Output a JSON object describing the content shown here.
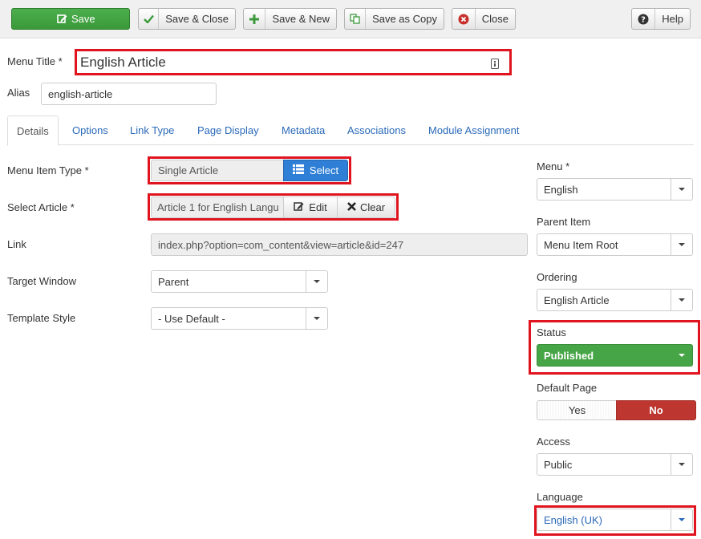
{
  "toolbar": {
    "save": "Save",
    "save_close": "Save & Close",
    "save_new": "Save & New",
    "save_copy": "Save as Copy",
    "close": "Close",
    "help": "Help"
  },
  "form": {
    "menu_title_label": "Menu Title *",
    "menu_title_value": "English Article",
    "alias_label": "Alias",
    "alias_value": "english-article"
  },
  "tabs": [
    "Details",
    "Options",
    "Link Type",
    "Page Display",
    "Metadata",
    "Associations",
    "Module Assignment"
  ],
  "details": {
    "menu_item_type_label": "Menu Item Type *",
    "menu_item_type_value": "Single Article",
    "select_button": "Select",
    "select_article_label": "Select Article *",
    "select_article_value": "Article 1 for English Langu",
    "edit_button": "Edit",
    "clear_button": "Clear",
    "link_label": "Link",
    "link_value": "index.php?option=com_content&view=article&id=247",
    "target_window_label": "Target Window",
    "target_window_value": "Parent",
    "template_style_label": "Template Style",
    "template_style_value": "- Use Default -"
  },
  "sidebar": {
    "menu_label": "Menu *",
    "menu_value": "English",
    "parent_label": "Parent Item",
    "parent_value": "Menu Item Root",
    "ordering_label": "Ordering",
    "ordering_value": "English Article",
    "status_label": "Status",
    "status_value": "Published",
    "default_page_label": "Default Page",
    "default_yes": "Yes",
    "default_no": "No",
    "access_label": "Access",
    "access_value": "Public",
    "language_label": "Language",
    "language_value": "English (UK)"
  },
  "colors": {
    "highlight": "#e0141e",
    "success": "#46a546",
    "danger": "#bd362f",
    "primary": "#2f7fd6",
    "link": "#2a69b8"
  }
}
